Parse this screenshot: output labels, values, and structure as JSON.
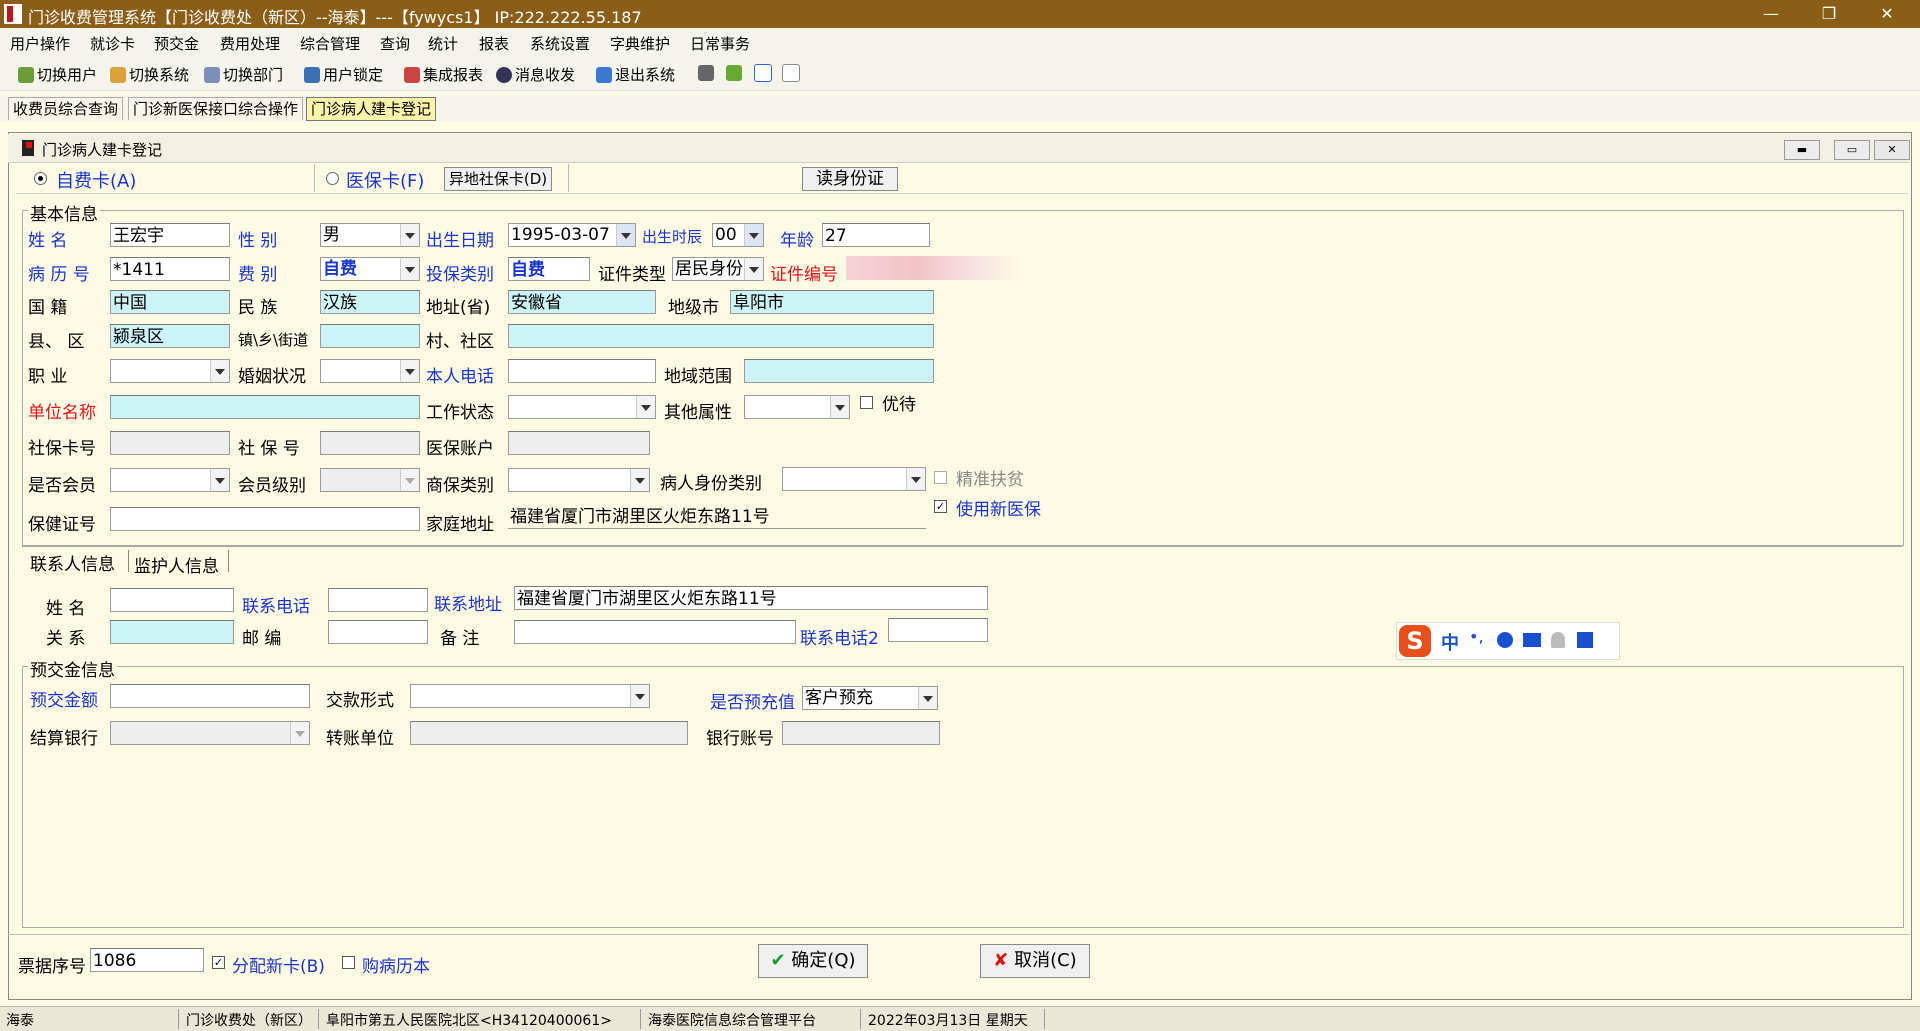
{
  "window": {
    "title": "门诊收费管理系统【门诊收费处（新区）--海泰】---【fywycs1】 IP:222.222.55.187",
    "minimize": "—",
    "maximize": "❐",
    "close": "✕"
  },
  "menu": [
    "用户操作",
    "就诊卡",
    "预交金",
    "费用处理",
    "综合管理",
    "查询",
    "统计",
    "报表",
    "系统设置",
    "字典维护",
    "日常事务"
  ],
  "toolbar": {
    "switch_user": "切换用户",
    "switch_system": "切换系统",
    "switch_dept": "切换部门",
    "user_lock": "用户锁定",
    "integrated_report": "集成报表",
    "messages": "消息收发",
    "exit": "退出系统"
  },
  "tabs": [
    "收费员综合查询",
    "门诊新医保接口综合操作",
    "门诊病人建卡登记"
  ],
  "form": {
    "title": "门诊病人建卡登记",
    "card_type": {
      "self_pay": "自费卡(A)",
      "insurance": "医保卡(F)",
      "remote_card": "异地社保卡(D)",
      "read_id": "读身份证"
    },
    "basic": {
      "group_label": "基本信息",
      "name_label": "姓    名",
      "name": "王宏宇",
      "gender_label": "性    别",
      "gender": "男",
      "birth_date_label": "出生日期",
      "birth_date": "1995-03-07",
      "birth_hour_label": "出生时辰",
      "birth_hour": "00",
      "age_label": "年龄",
      "age": "27",
      "record_no_label": "病 历 号",
      "record_no": "*1411",
      "fee_type_label": "费    别",
      "fee_type": "自费",
      "insure_type_label": "投保类别",
      "insure_type": "自费",
      "cert_type_label": "证件类型",
      "cert_type": "居民身份",
      "cert_no_label": "证件编号",
      "nationality_label": "国    籍",
      "nationality": "中国",
      "ethnic_label": "民    族",
      "ethnic": "汉族",
      "province_label": "地址(省)",
      "province": "安徽省",
      "city_label": "地级市",
      "city": "阜阳市",
      "county_label": "县、  区",
      "county": "颍泉区",
      "town_label": "镇\\乡\\街道",
      "town": "",
      "village_label": "村、社区",
      "village": "",
      "job_label": "职    业",
      "job": "",
      "marriage_label": "婚姻状况",
      "marriage": "",
      "phone_label": "本人电话",
      "phone": "",
      "region_label": "地域范围",
      "region": "",
      "employer_label": "单位名称",
      "employer": "",
      "work_status_label": "工作状态",
      "work_status": "",
      "other_attr_label": "其他属性",
      "other_attr": "",
      "priority_label": "优待",
      "si_card_label": "社保卡号",
      "si_card": "",
      "si_no_label": "社 保 号",
      "si_no": "",
      "mi_account_label": "医保账户",
      "mi_account": "",
      "member_label": "是否会员",
      "member": "",
      "member_level_label": "会员级别",
      "member_level": "",
      "commercial_label": "商保类别",
      "commercial": "",
      "identity_label": "病人身份类别",
      "identity": "",
      "poverty_label": "精准扶贫",
      "new_mi_label": "使用新医保",
      "health_cert_label": "保健证号",
      "health_cert": "",
      "home_addr_label": "家庭地址",
      "home_addr": "福建省厦门市湖里区火炬东路11号"
    },
    "contact": {
      "tab1": "联系人信息",
      "tab2": "监护人信息",
      "name_label": "姓    名",
      "name": "",
      "phone_label": "联系电话",
      "phone": "",
      "addr_label": "联系地址",
      "addr": "福建省厦门市湖里区火炬东路11号",
      "relation_label": "关    系",
      "relation": "",
      "zip_label": "邮    编",
      "zip": "",
      "note_label": "备    注",
      "note": "",
      "phone2_label": "联系电话2",
      "phone2": ""
    },
    "deposit": {
      "group_label": "预交金信息",
      "amount_label": "预交金额",
      "amount": "",
      "pay_method_label": "交款形式",
      "pay_method": "",
      "recharge_label": "是否预充值",
      "recharge": "客户预充",
      "bank_label": "结算银行",
      "bank": "",
      "transfer_unit_label": "转账单位",
      "transfer_unit": "",
      "bank_account_label": "银行账号",
      "bank_account": ""
    },
    "footer": {
      "receipt_label": "票据序号",
      "receipt": "1086",
      "assign_card": "分配新卡(B)",
      "buy_record": "购病历本",
      "ok": "确定(Q)",
      "cancel": "取消(C)"
    }
  },
  "ime": {
    "mode": "中",
    "punct": "•,"
  },
  "status": [
    "海泰",
    "门诊收费处（新区）",
    "阜阳市第五人民医院北区<H34120400061>",
    "海泰医院信息综合管理平台",
    "2022年03月13日  星期天"
  ]
}
